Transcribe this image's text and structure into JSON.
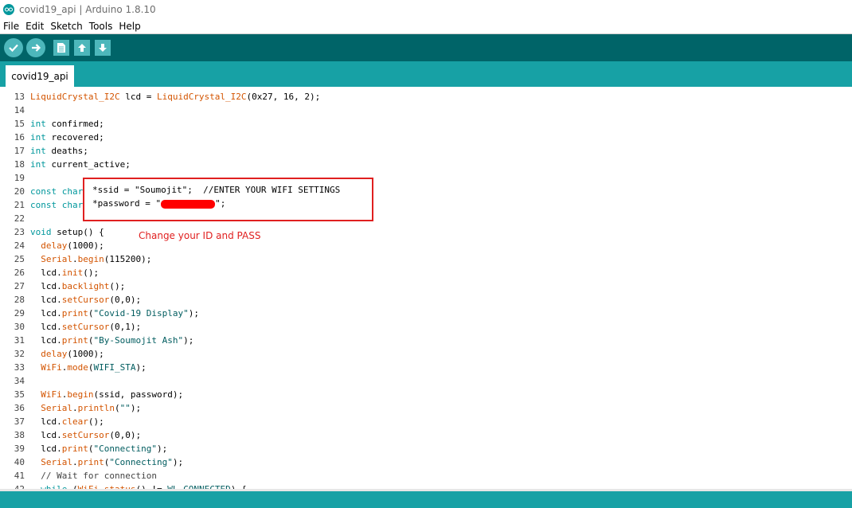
{
  "window": {
    "title": "covid19_api | Arduino 1.8.10"
  },
  "menu": [
    "File",
    "Edit",
    "Sketch",
    "Tools",
    "Help"
  ],
  "toolbar": {
    "verify": "verify-icon",
    "upload": "upload-arrow-icon",
    "new": "new-file-icon",
    "open": "open-icon",
    "save": "save-icon"
  },
  "tab": {
    "label": "covid19_api"
  },
  "code_lines": [
    {
      "n": "13",
      "text": "LiquidCrystal_I2C lcd = LiquidCrystal_I2C(0x27, 16, 2);"
    },
    {
      "n": "14",
      "text": ""
    },
    {
      "n": "15",
      "text": "int confirmed;"
    },
    {
      "n": "16",
      "text": "int recovered;"
    },
    {
      "n": "17",
      "text": "int deaths;"
    },
    {
      "n": "18",
      "text": "int current_active;"
    },
    {
      "n": "19",
      "text": ""
    },
    {
      "n": "20",
      "text": "const char"
    },
    {
      "n": "21",
      "text": "const char"
    },
    {
      "n": "22",
      "text": ""
    },
    {
      "n": "23",
      "text": "void setup() {"
    },
    {
      "n": "24",
      "text": "  delay(1000);"
    },
    {
      "n": "25",
      "text": "  Serial.begin(115200);"
    },
    {
      "n": "26",
      "text": "  lcd.init();"
    },
    {
      "n": "27",
      "text": "  lcd.backlight();"
    },
    {
      "n": "28",
      "text": "  lcd.setCursor(0,0);"
    },
    {
      "n": "29",
      "text": "  lcd.print(\"Covid-19 Display\");"
    },
    {
      "n": "30",
      "text": "  lcd.setCursor(0,1);"
    },
    {
      "n": "31",
      "text": "  lcd.print(\"By-Soumojit Ash\");"
    },
    {
      "n": "32",
      "text": "  delay(1000);"
    },
    {
      "n": "33",
      "text": "  WiFi.mode(WIFI_STA);"
    },
    {
      "n": "34",
      "text": ""
    },
    {
      "n": "35",
      "text": "  WiFi.begin(ssid, password);"
    },
    {
      "n": "36",
      "text": "  Serial.println(\"\");"
    },
    {
      "n": "37",
      "text": "  lcd.clear();"
    },
    {
      "n": "38",
      "text": "  lcd.setCursor(0,0);"
    },
    {
      "n": "39",
      "text": "  lcd.print(\"Connecting\");"
    },
    {
      "n": "40",
      "text": "  Serial.print(\"Connecting\");"
    },
    {
      "n": "41",
      "text": "  // Wait for connection"
    },
    {
      "n": "42",
      "text": "  while (WiFi.status() != WL_CONNECTED) {"
    }
  ],
  "highlight": {
    "line1": "*ssid = \"Soumojit\";  //ENTER YOUR WIFI SETTINGS",
    "line2_prefix": "*password = \"",
    "line2_suffix": "\";"
  },
  "annotation": "Change your ID and PASS",
  "colors": {
    "teal_dark": "#006468",
    "teal": "#17a1a5",
    "annotation_red": "#e02020"
  }
}
